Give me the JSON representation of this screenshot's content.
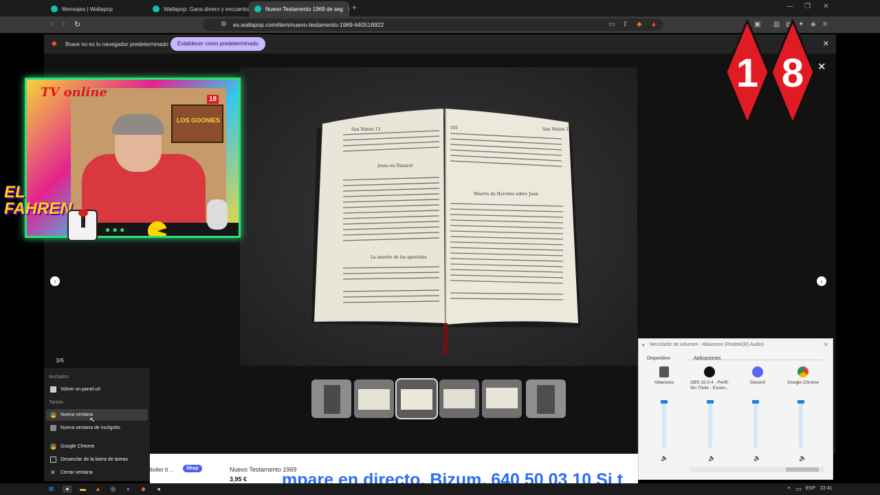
{
  "tabs": [
    {
      "label": "Mensajes | Wallapop"
    },
    {
      "label": "Wallapop: Gana dinero y encuentra c"
    },
    {
      "label": "Nuevo Testamento 1969 de seg"
    }
  ],
  "address": {
    "url": "es.wallapop.com/item/nuevo-testamento-1969-640518922"
  },
  "infobar": {
    "message": "Brave no es tu navegador predeterminado",
    "button": "Establecer como predeterminado"
  },
  "gallery": {
    "counter": "3/6",
    "thumbnail_count": 6,
    "selected_thumbnail": 3
  },
  "badge": {
    "digit1": "1",
    "digit2": "8"
  },
  "overlay": {
    "tv_title": "TV online",
    "fahren": "EL FAHREN",
    "badge_small": "18",
    "poster_text": "LOS GOONIES"
  },
  "book": {
    "left_header": "San Mateo 13",
    "left_heading1": "Jesús en Nazaret",
    "left_heading2": "La muerte de los apóstoles",
    "right_header": "San Mateo 14",
    "right_heading": "Muerte de Herodes sobre Juan",
    "right_page_no": "101"
  },
  "jumplist": {
    "pinned_header": "Anclados",
    "pinned": [
      "Volver un panel.url"
    ],
    "tasks_header": "Tareas",
    "tasks": [
      "Nueva ventana",
      "Nueva ventana de incógnito"
    ],
    "app": [
      "Google Chrome",
      "Desanclar de la barra de tareas",
      "Cerrar ventana"
    ]
  },
  "listing": {
    "seller": "llollet tt ..",
    "shop_badge": "Shop",
    "title": "Nuevo Testamento 1969",
    "price": "3,95 €"
  },
  "ticker": {
    "text": "mpare en directo. Bizum, 640 50 03 10 Si t"
  },
  "mixer": {
    "title": "Mezclador de volumen - Altavoces (Realtek(R) Audio)",
    "device_header": "Dispositivo",
    "apps_header": "Aplicaciones",
    "channels": [
      {
        "name": "Altavoces",
        "level": 0.95
      },
      {
        "name": "OBS 32.0.4 - Perfil: Sin Título - Escen...",
        "level": 0.95
      },
      {
        "name": "Discord",
        "level": 0.95
      },
      {
        "name": "Google Chrome",
        "level": 0.95
      }
    ]
  },
  "taskbar": {
    "lang": "ESP",
    "time": "22:41"
  },
  "colors": {
    "accent": "#13c1ac",
    "badge_red": "#e11b22",
    "mixer_blue": "#1e80d8"
  }
}
